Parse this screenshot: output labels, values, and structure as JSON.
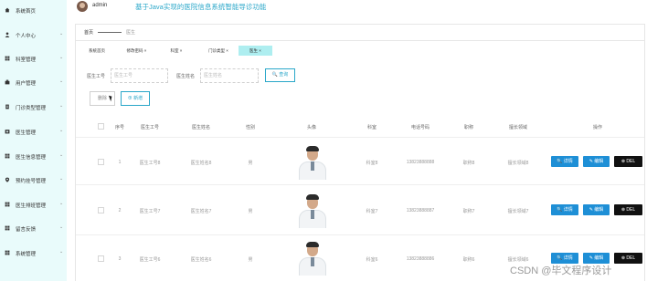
{
  "header": {
    "username": "admin",
    "app_title": "基于Java实现的医院信息系统智能导诊功能"
  },
  "sidebar": {
    "items": [
      {
        "label": "系统首页",
        "icon": "home-icon",
        "chevron": ""
      },
      {
        "label": "个人中心",
        "icon": "person-icon",
        "chevron": "⌄"
      },
      {
        "label": "科室管理",
        "icon": "grid-icon",
        "chevron": "⌄"
      },
      {
        "label": "用户管理",
        "icon": "building-icon",
        "chevron": "⌄"
      },
      {
        "label": "门诊类型管理",
        "icon": "document-icon",
        "chevron": "⌄"
      },
      {
        "label": "医生管理",
        "icon": "doctor-icon",
        "chevron": "⌄"
      },
      {
        "label": "医生信息管理",
        "icon": "grid-icon",
        "chevron": "⌄"
      },
      {
        "label": "预约挂号管理",
        "icon": "pin-icon",
        "chevron": "⌄"
      },
      {
        "label": "医生排班管理",
        "icon": "grid-icon",
        "chevron": "⌄"
      },
      {
        "label": "留言反馈",
        "icon": "grid-icon",
        "chevron": "⌄"
      },
      {
        "label": "系统管理",
        "icon": "grid-icon",
        "chevron": "⌄"
      }
    ]
  },
  "breadcrumb": {
    "home": "首页",
    "current": "医生"
  },
  "topnav": {
    "items": [
      {
        "label": "系统首页"
      },
      {
        "label": "修改密码 ×"
      },
      {
        "label": "科室 ×"
      },
      {
        "label": "门诊类型 ×"
      },
      {
        "label": "医生 ×"
      }
    ]
  },
  "search": {
    "field1_label": "医生工号",
    "field1_placeholder": "医生工号",
    "field2_label": "医生姓名",
    "field2_placeholder": "医生姓名",
    "button_label": "🔍 查询"
  },
  "actions": {
    "delete_label": "删除",
    "add_label": "⊕ 新增"
  },
  "table": {
    "columns": [
      "序号",
      "医生工号",
      "医生姓名",
      "性别",
      "头像",
      "科室",
      "电话号码",
      "职称",
      "擅长领域",
      "操作"
    ],
    "rows": [
      {
        "index": "1",
        "doctor_no": "医生工号8",
        "doctor_name": "医生姓名8",
        "gender": "男",
        "dept": "科室8",
        "phone": "13823888888",
        "title": "职称8",
        "specialty": "擅长领域8"
      },
      {
        "index": "2",
        "doctor_no": "医生工号7",
        "doctor_name": "医生姓名7",
        "gender": "男",
        "dept": "科室7",
        "phone": "13823888887",
        "title": "职称7",
        "specialty": "擅长领域7"
      },
      {
        "index": "3",
        "doctor_no": "医生工号6",
        "doctor_name": "医生姓名6",
        "gender": "男",
        "dept": "科室6",
        "phone": "13823888886",
        "title": "职称6",
        "specialty": "擅长领域6"
      }
    ],
    "op_detail": "🔍 详情",
    "op_edit": "✎ 编辑",
    "op_del": "⊗ DEL"
  },
  "watermark": "CSDN @毕文程序设计",
  "colors": {
    "sidebar_bg": "#e9fbfb",
    "accent": "#2aa7c9",
    "button_blue": "#1e8fd6",
    "button_dark": "#111111",
    "active_tab": "#aeeef0"
  }
}
